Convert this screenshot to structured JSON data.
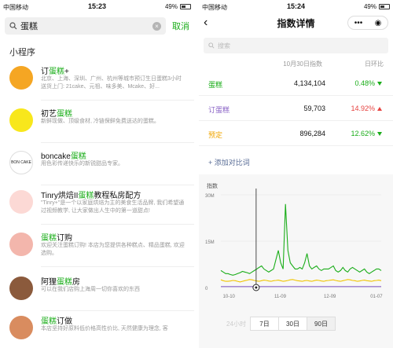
{
  "left": {
    "status": {
      "carrier": "中国移动",
      "time": "15:23",
      "battery": "49%"
    },
    "search": {
      "query": "蛋糕",
      "cancel": "取消"
    },
    "section_title": "小程序",
    "items": [
      {
        "title_pre": "订",
        "title_hl": "蛋糕",
        "title_post": "+",
        "desc": "北京、上海、深圳、广州、杭州等城市预订生日蛋糕3小时送货上门: 21cake、元祖、味多美、Mcake、好...",
        "avatar_color": "#f5a623"
      },
      {
        "title_pre": "初艺",
        "title_hl": "蛋糕",
        "title_post": "",
        "desc": "新鲜现做、顶级食材, 冷链保鲜免费送达的蛋糕。",
        "avatar_color": "#f8e71c"
      },
      {
        "title_pre": "boncake",
        "title_hl": "蛋糕",
        "title_post": "",
        "desc": "用色彩传递快乐的新锐甜品专家。",
        "avatar_color": "#ffffff"
      },
      {
        "title_pre": "Tinry烘焙II",
        "title_hl": "蛋糕",
        "title_post": "教程私房配方",
        "desc": "\"Tinry+\"是一个以家庭烘焙为主的美食生活品牌, 我们希望通过视频教学, 让大家做出人生中的第一道甜点!",
        "avatar_color": "#fcd9d5"
      },
      {
        "title_pre": "",
        "title_hl": "蛋糕",
        "title_post": "订购",
        "desc": "欢迎关注蛋糕订购! 本店为您提供各种糕点、精品蛋糕, 欢迎选购。",
        "avatar_color": "#f3b6ac"
      },
      {
        "title_pre": "阿狸",
        "title_hl": "蛋糕",
        "title_post": "房",
        "desc": "可以在我们店购上海周一切你喜欢的东西",
        "avatar_color": "#8b5a3c"
      },
      {
        "title_pre": "",
        "title_hl": "蛋糕",
        "title_post": "订做",
        "desc": "本店坚持好原料低价格高性价比, 天然健康为理念, 客",
        "avatar_color": "#d98c5f"
      }
    ],
    "boncake_logo": "BON CAKE"
  },
  "right": {
    "status": {
      "carrier": "中国移动",
      "time": "15:24",
      "battery": "49%"
    },
    "nav": {
      "title": "指数详情",
      "back": "‹",
      "capsule_more": "•••",
      "capsule_close": "◉"
    },
    "search_placeholder": "搜索",
    "table_head": {
      "col_index": "10月30日指数",
      "col_change": "日环比"
    },
    "rows": [
      {
        "name": "蛋糕",
        "value": "4,134,104",
        "change": "0.48%",
        "trend": "down",
        "color": "#1aad19",
        "change_color": "#1aad19"
      },
      {
        "name": "订蛋糕",
        "value": "59,703",
        "change": "14.92%",
        "trend": "up",
        "color": "#8a63c6",
        "change_color": "#e64340"
      },
      {
        "name": "预定",
        "value": "896,284",
        "change": "12.62%",
        "trend": "down",
        "color": "#f0a500",
        "change_color": "#1aad19"
      }
    ],
    "add_compare": "+ 添加对比词",
    "range_tabs": [
      {
        "label": "24小时",
        "state": "disabled"
      },
      {
        "label": "7日",
        "state": "normal"
      },
      {
        "label": "30日",
        "state": "normal"
      },
      {
        "label": "90日",
        "state": "active"
      }
    ]
  },
  "chart_data": {
    "type": "line",
    "title": "",
    "ylabel": "指数",
    "y_ticks": [
      "30M",
      "15M",
      "0"
    ],
    "ylim": [
      0,
      30000000
    ],
    "x_ticks": [
      "10-10",
      "11-09",
      "12-09",
      "01-07"
    ],
    "series": [
      {
        "name": "蛋糕",
        "color": "#1aad19",
        "values": [
          5.5,
          5,
          4.5,
          4.5,
          4.2,
          4,
          4.2,
          4.5,
          4.8,
          5.2,
          5,
          4.8,
          4.5,
          5,
          5.5,
          6,
          6.5,
          7,
          6,
          5.5,
          5,
          5.5,
          6,
          9,
          12,
          8,
          6,
          27,
          12,
          8,
          7,
          6,
          6,
          6.5,
          6,
          8,
          11,
          7,
          6,
          6.5,
          7,
          6,
          5.5,
          6,
          6,
          6,
          6.5,
          7,
          5.5,
          5,
          5.5,
          6.5,
          5.5,
          5,
          6,
          6.5,
          6,
          5.5,
          5,
          5.5,
          6,
          5,
          4.5,
          5,
          5.5,
          6,
          6,
          5.5
        ]
      },
      {
        "name": "订蛋糕",
        "color": "#8a63c6",
        "values": [
          0.3,
          0.3,
          0.3,
          0.3,
          0.3,
          0.3,
          0.3,
          0.3,
          0.3,
          0.3,
          0.3,
          0.3,
          0.3,
          0.3,
          0.3,
          0.3,
          0.3,
          0.3,
          0.3,
          0.3,
          0.3,
          0.3,
          0.3,
          0.3,
          0.3,
          0.3,
          0.3,
          0.3,
          0.3,
          0.3,
          0.3,
          0.3,
          0.3,
          0.3,
          0.3,
          0.3,
          0.3,
          0.3,
          0.3,
          0.3,
          0.3,
          0.3,
          0.3,
          0.3,
          0.3,
          0.3,
          0.3,
          0.3,
          0.3,
          0.3,
          0.3,
          0.3,
          0.3,
          0.3,
          0.3,
          0.3,
          0.3,
          0.3,
          0.3,
          0.3,
          0.3,
          0.3,
          0.3,
          0.3,
          0.3,
          0.3,
          0.3,
          0.3
        ]
      },
      {
        "name": "预定",
        "color": "#f0c400",
        "values": [
          2.5,
          2.2,
          2,
          2,
          2.1,
          2.3,
          2.2,
          2,
          1.8,
          2,
          2.2,
          2.4,
          2.6,
          2.5,
          2.3,
          2.1,
          2,
          2.2,
          2.4,
          2.3,
          2.1,
          2,
          2.2,
          2.3,
          2.4,
          2.2,
          2,
          2.1,
          2.3,
          2.5,
          2.6,
          2.4,
          2.2,
          2.1,
          2,
          2.2,
          2.3,
          2.1,
          2,
          2.2,
          2.4,
          2.3,
          2.1,
          2,
          2.2,
          2.3,
          2.4,
          2.5,
          2.3,
          2.1,
          2,
          2.2,
          2.4,
          2.6,
          2.5,
          2.3,
          2.2,
          2,
          2.1,
          2.3,
          2.4,
          2.2,
          2.1,
          2,
          2.2,
          2.3,
          2.4,
          2.2
        ]
      }
    ]
  }
}
